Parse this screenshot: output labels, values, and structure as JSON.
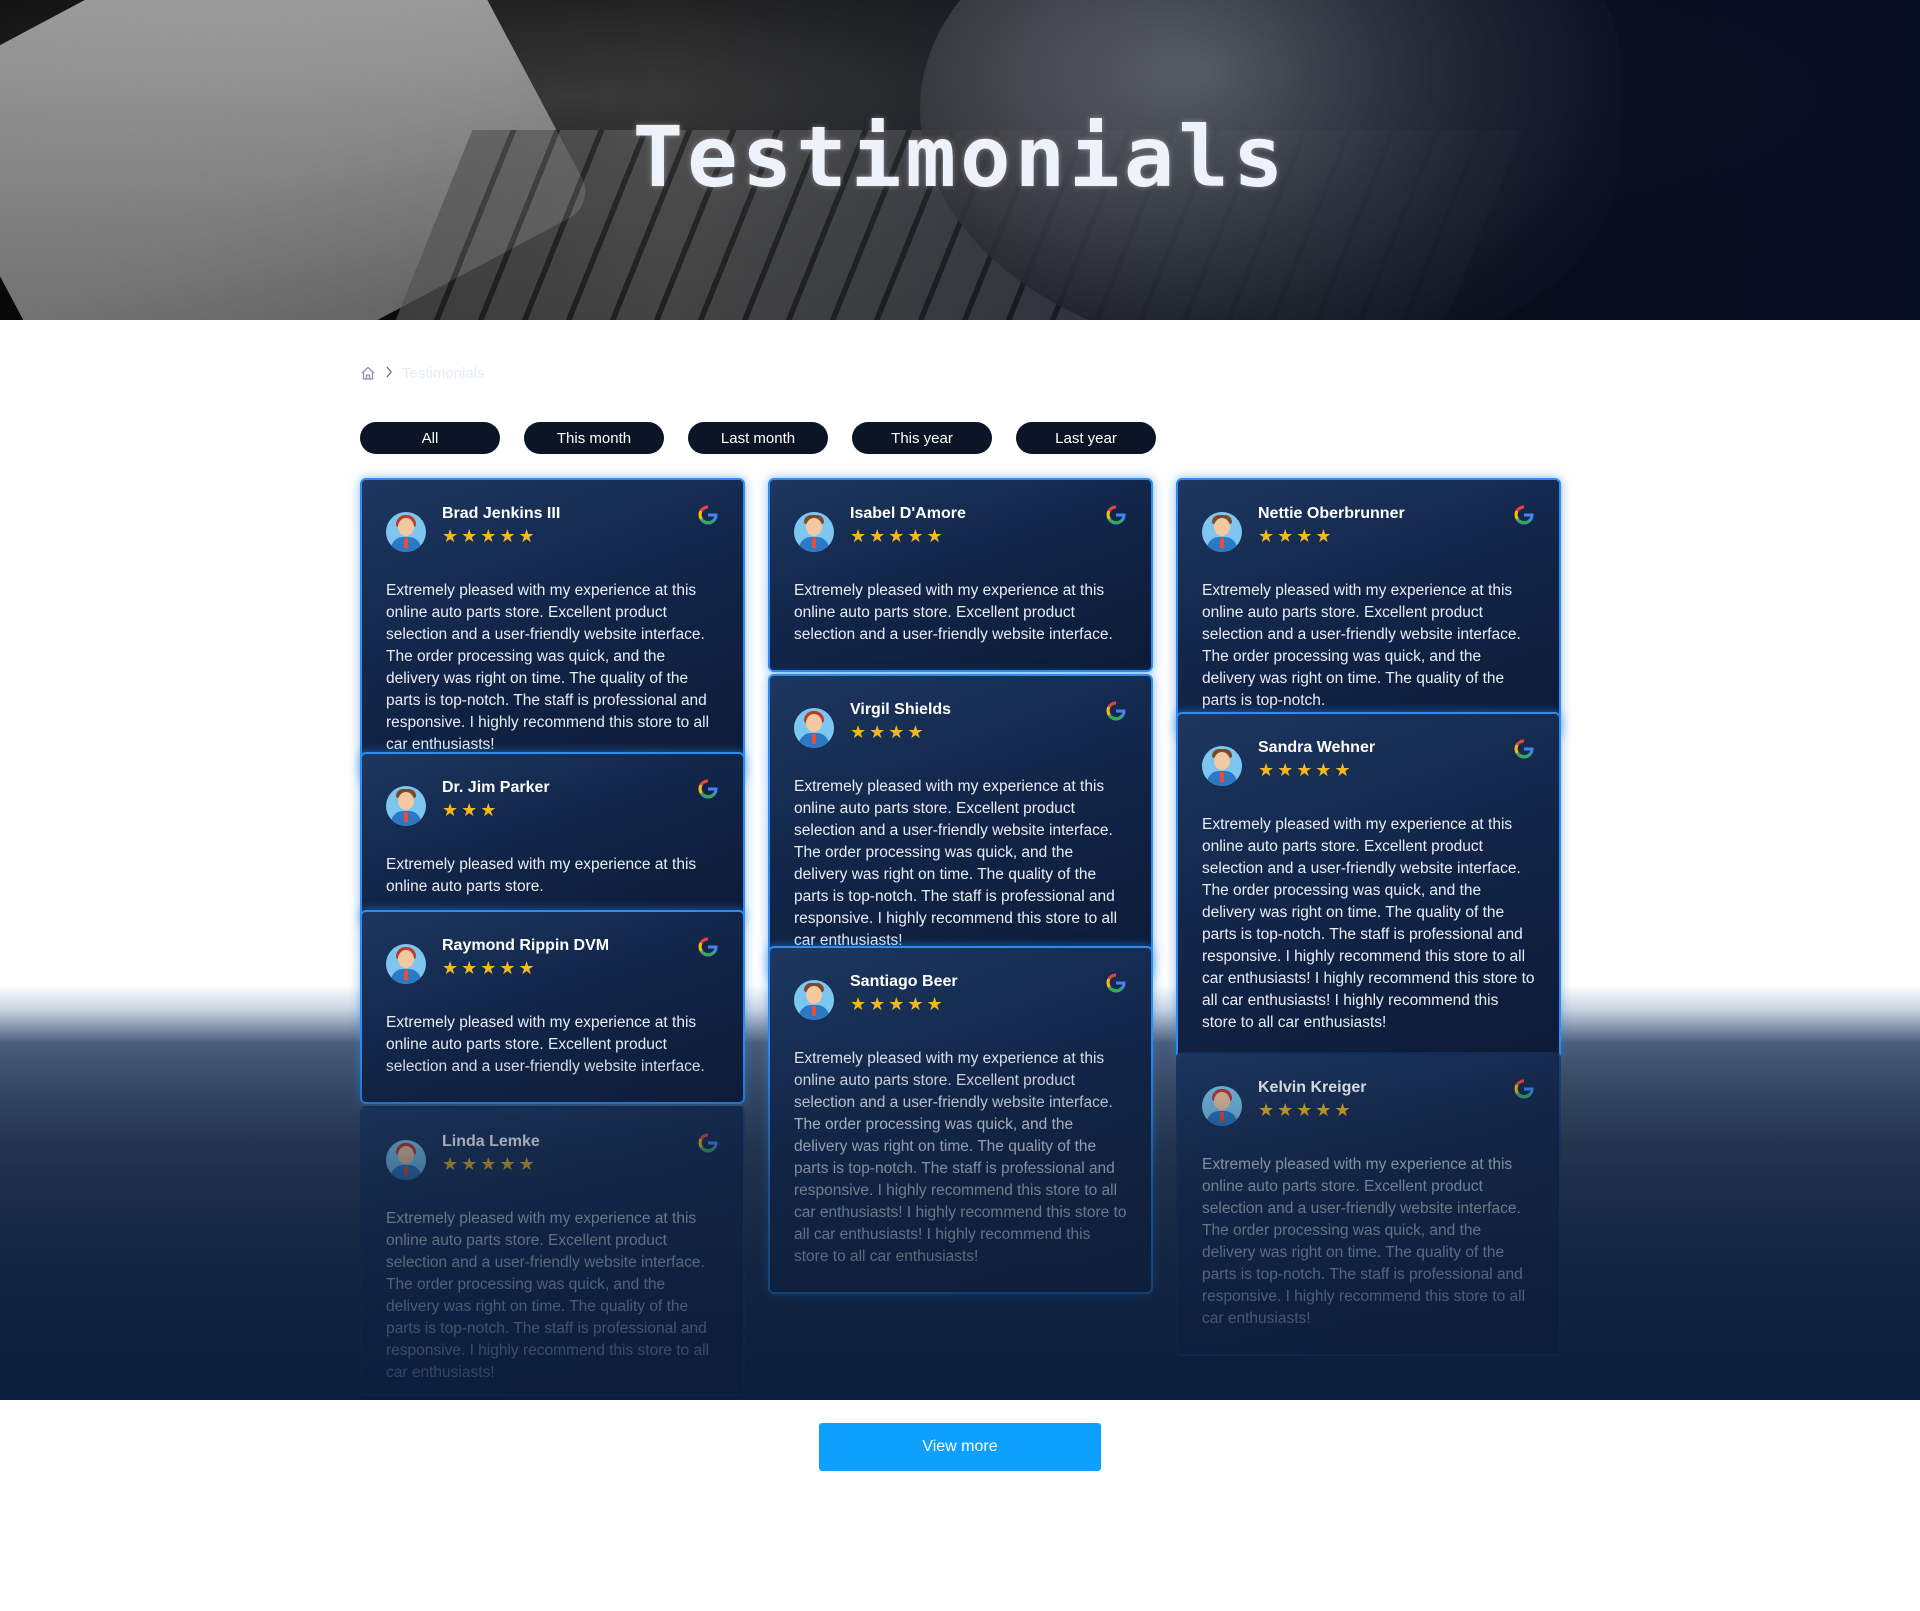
{
  "hero": {
    "title": "Testimonials"
  },
  "breadcrumb": {
    "home_icon": "home-icon",
    "current": "Testimonials"
  },
  "filters": [
    "All",
    "This month",
    "Last month",
    "This year",
    "Last year"
  ],
  "view_more_label": "View more",
  "colors": {
    "accent": "#0ea0ff",
    "card_border": "#2d8cf0",
    "star": "#f5b820",
    "filter_bg": "#0c1526"
  },
  "columns": [
    [
      {
        "name": "Brad Jenkins III",
        "rating": 5,
        "stars": "★★★★★",
        "avatar": "avatar-red-hair",
        "source_icon": "google-icon",
        "text": "Extremely pleased with my experience at this online auto parts store. Excellent product selection and a user-friendly website interface. The order processing was quick, and the delivery was right on time. The quality of the parts is top-notch. The staff is professional and responsive. I highly recommend this store to all car enthusiasts!"
      },
      {
        "name": "Dr. Jim Parker",
        "rating": 3,
        "stars": "★★★",
        "avatar": "avatar-brown-hair",
        "source_icon": "google-icon",
        "text": "Extremely pleased with my experience at this online auto parts store."
      },
      {
        "name": "Raymond Rippin DVM",
        "rating": 5,
        "stars": "★★★★★",
        "avatar": "avatar-red-hair",
        "source_icon": "google-icon",
        "text": "Extremely pleased with my experience at this online auto parts store. Excellent product selection and a user-friendly website interface."
      },
      {
        "name": "Linda Lemke",
        "rating": 5,
        "stars": "★★★★★",
        "avatar": "avatar-red-hair",
        "source_icon": "google-icon",
        "text": "Extremely pleased with my experience at this online auto parts store. Excellent product selection and a user-friendly website interface. The order processing was quick, and the delivery was right on time. The quality of the parts is top-notch. The staff is professional and responsive. I highly recommend this store to all car enthusiasts!"
      }
    ],
    [
      {
        "name": "Isabel D'Amore",
        "rating": 5,
        "stars": "★★★★★",
        "avatar": "avatar-brown-hair",
        "source_icon": "google-icon",
        "text": "Extremely pleased with my experience at this online auto parts store. Excellent product selection and a user-friendly website interface."
      },
      {
        "name": "Virgil Shields",
        "rating": 4,
        "stars": "★★★★",
        "avatar": "avatar-red-hair",
        "source_icon": "google-icon",
        "text": "Extremely pleased with my experience at this online auto parts store. Excellent product selection and a user-friendly website interface. The order processing was quick, and the delivery was right on time. The quality of the parts is top-notch. The staff is professional and responsive. I highly recommend this store to all car enthusiasts!"
      },
      {
        "name": "Santiago Beer",
        "rating": 5,
        "stars": "★★★★★",
        "avatar": "avatar-brown-hair",
        "source_icon": "google-icon",
        "text": "Extremely pleased with my experience at this online auto parts store. Excellent product selection and a user-friendly website interface. The order processing was quick, and the delivery was right on time. The quality of the parts is top-notch. The staff is professional and responsive. I highly recommend this store to all car enthusiasts! I highly recommend this store to all car enthusiasts! I highly recommend this store to all car enthusiasts!"
      }
    ],
    [
      {
        "name": "Nettie Oberbrunner",
        "rating": 4,
        "stars": "★★★★",
        "avatar": "avatar-brown-hair",
        "source_icon": "google-icon",
        "text": "Extremely pleased with my experience at this online auto parts store. Excellent product selection and a user-friendly website interface. The order processing was quick, and the delivery was right on time. The quality of the parts is top-notch."
      },
      {
        "name": "Sandra Wehner",
        "rating": 5,
        "stars": "★★★★★",
        "avatar": "avatar-brown-hair",
        "source_icon": "google-icon",
        "text": "Extremely pleased with my experience at this online auto parts store. Excellent product selection and a user-friendly website interface. The order processing was quick, and the delivery was right on time. The quality of the parts is top-notch. The staff is professional and responsive. I highly recommend this store to all car enthusiasts! I highly recommend this store to all car enthusiasts! I highly recommend this store to all car enthusiasts!"
      },
      {
        "name": "Kelvin Kreiger",
        "rating": 5,
        "stars": "★★★★★",
        "avatar": "avatar-red-hair",
        "source_icon": "google-icon",
        "text": "Extremely pleased with my experience at this online auto parts store. Excellent product selection and a user-friendly website interface. The order processing was quick, and the delivery was right on time. The quality of the parts is top-notch. The staff is professional and responsive. I highly recommend this store to all car enthusiasts!"
      }
    ]
  ]
}
